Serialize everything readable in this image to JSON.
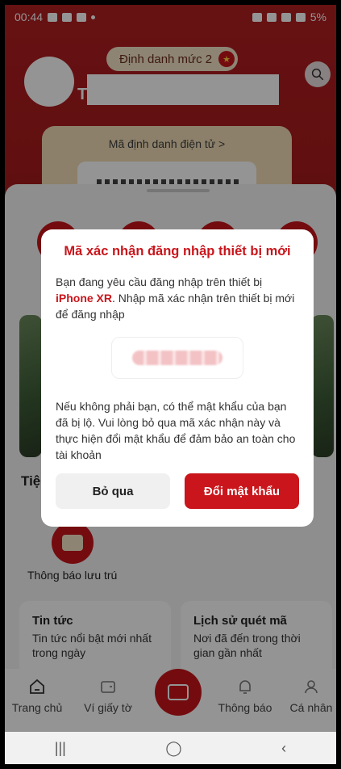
{
  "status_bar": {
    "time": "00:44",
    "battery": "5%"
  },
  "header": {
    "level_chip": "Định danh mức 2",
    "name_initial": "T",
    "id_card_label": "Mã định danh điện tử  >"
  },
  "sections": {
    "services_title": "Tiệ",
    "service_label": "Thông báo lưu trú"
  },
  "info_cards": [
    {
      "title": "Tin tức",
      "desc": "Tin tức nổi bật mới nhất trong ngày"
    },
    {
      "title": "Lịch sử quét mã",
      "desc": "Nơi đã đến trong thời gian gần nhất"
    }
  ],
  "bottom_nav": [
    {
      "label": "Trang chủ"
    },
    {
      "label": "Ví giấy tờ"
    },
    {
      "label": "Thông báo"
    },
    {
      "label": "Cá nhân"
    }
  ],
  "dialog": {
    "title": "Mã xác nhận đăng nhập thiết bị mới",
    "body_before": "Bạn đang yêu cầu đăng nhập trên thiết bị ",
    "device": "iPhone XR",
    "body_after": ". Nhập mã xác nhận trên thiết bị mới để đăng nhập",
    "warning": "Nếu không phải bạn, có thể mật khẩu của bạn đã bị lộ. Vui lòng bỏ qua mã xác nhận này và thực hiện đổi mật khẩu để đảm bảo an toàn cho tài khoản",
    "skip_label": "Bỏ qua",
    "change_label": "Đổi mật khẩu"
  },
  "colors": {
    "brand_red": "#c9151b",
    "header_red": "#b01e20",
    "cream": "#f1ddb7"
  }
}
